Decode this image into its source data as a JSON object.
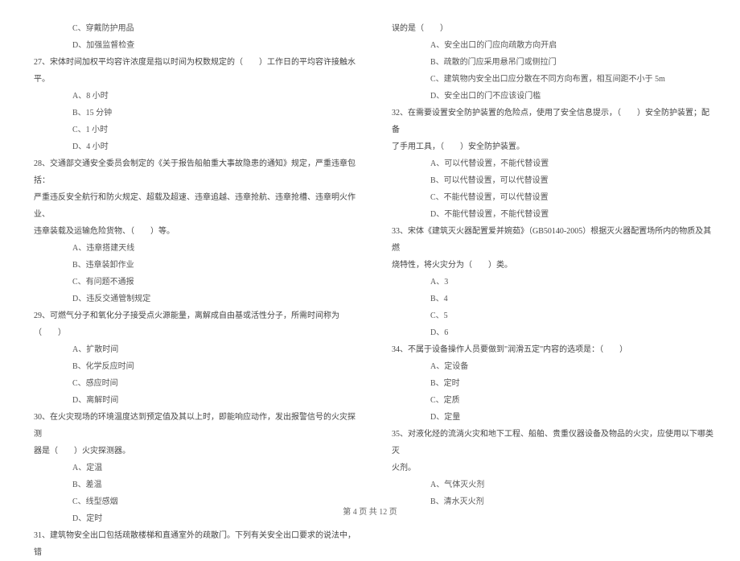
{
  "left": {
    "opt_c_26": "C、穿戴防护用品",
    "opt_d_26": "D、加强监督检查",
    "q27": "27、宋体时间加权平均容许浓度是指以时间为权数规定的（　　）工作日的平均容许接触水平。",
    "q27_a": "A、8 小时",
    "q27_b": "B、15 分钟",
    "q27_c": "C、1 小时",
    "q27_d": "D、4 小时",
    "q28_1": "28、交通部交通安全委员会制定的《关于报告船舶重大事故隐患的通知》规定，严重违章包括：",
    "q28_2": "严重违反安全航行和防火规定、超载及超速、违章追越、违章抢航、违章抢槽、违章明火作业、",
    "q28_3": "违章装载及运输危险货物、（　　）等。",
    "q28_a": "A、违章搭建天线",
    "q28_b": "B、违章装卸作业",
    "q28_c": "C、有问题不通报",
    "q28_d": "D、违反交通管制规定",
    "q29": "29、可燃气分子和氧化分子接受点火源能量，离解成自由基或活性分子，所需时间称为（　　）",
    "q29_a": "A、扩散时间",
    "q29_b": "B、化学反应时间",
    "q29_c": "C、感应时间",
    "q29_d": "D、离解时间",
    "q30_1": "30、在火灾现场的环境温度达到预定值及其以上时，即能响应动作，发出报警信号的火灾探测",
    "q30_2": "器是（　　）火灾探测器。",
    "q30_a": "A、定温",
    "q30_b": "B、差温",
    "q30_c": "C、线型感烟",
    "q30_d": "D、定时",
    "q31": "31、建筑物安全出口包括疏散楼梯和直通室外的疏散门。下列有关安全出口要求的说法中，错"
  },
  "right": {
    "q31_cont": "误的是（　　）",
    "q31_a": "A、安全出口的门应向疏散方向开启",
    "q31_b": "B、疏散的门应采用悬吊门或侧拉门",
    "q31_c": "C、建筑物内安全出口应分散在不同方向布置，相互间距不小于 5m",
    "q31_d": "D、安全出口的门不应该设门槛",
    "q32_1": "32、在需要设置安全防护装置的危险点，使用了安全信息提示，（　　）安全防护装置；配备",
    "q32_2": "了手用工具，（　　）安全防护装置。",
    "q32_a": "A、可以代替设置，不能代替设置",
    "q32_b": "B、可以代替设置，可以代替设置",
    "q32_c": "C、不能代替设置，可以代替设置",
    "q32_d": "D、不能代替设置，不能代替设置",
    "q33_1": "33、宋体《建筑灭火器配置爱并婉茹》（GB50140-2005）根据灭火器配置场所内的物质及其燃",
    "q33_2": "烧特性，将火灾分为（　　）类。",
    "q33_a": "A、3",
    "q33_b": "B、4",
    "q33_c": "C、5",
    "q33_d": "D、6",
    "q34": "34、不属于设备操作人员要做到\"润滑五定\"内容的选项是：（　　）",
    "q34_a": "A、定设备",
    "q34_b": "B、定时",
    "q34_c": "C、定质",
    "q34_d": "D、定量",
    "q35_1": "35、对液化烃的流淌火灾和地下工程、船舶、贵重仪器设备及物品的火灾，应使用以下哪类灭",
    "q35_2": "火剂。",
    "q35_a": "A、气体灭火剂",
    "q35_b": "B、清水灭火剂"
  },
  "footer": "第 4 页 共 12 页"
}
